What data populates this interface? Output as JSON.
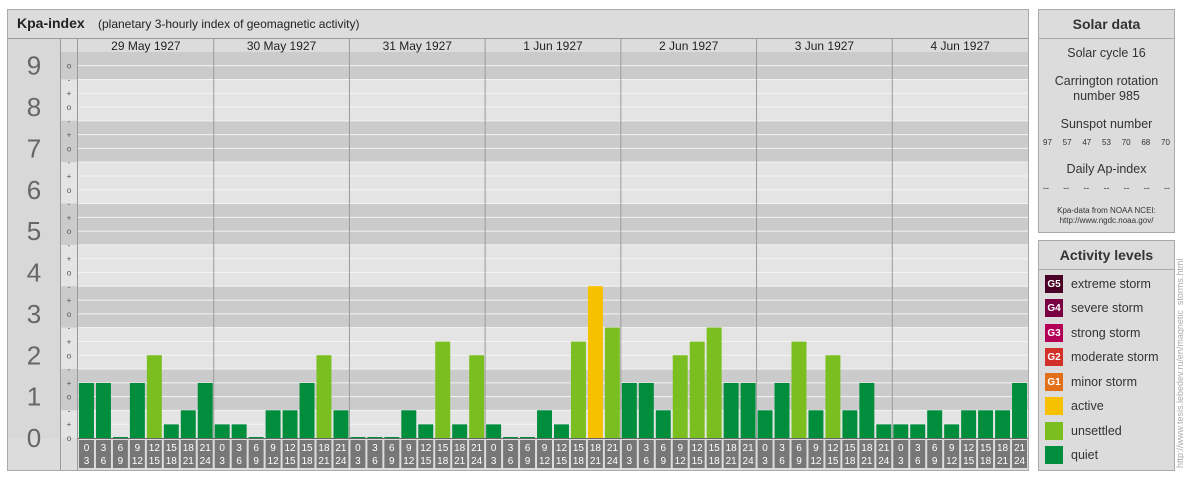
{
  "chart_data": {
    "type": "bar",
    "title": "Kpa-index",
    "subtitle": "(planetary 3-hourly index of geomagnetic activity)",
    "days": [
      "29 May 1927",
      "30 May 1927",
      "31 May 1927",
      "1 Jun 1927",
      "2 Jun 1927",
      "3 Jun 1927",
      "4 Jun 1927"
    ],
    "interval_labels": [
      [
        "0",
        "3"
      ],
      [
        "3",
        "6"
      ],
      [
        "6",
        "9"
      ],
      [
        "9",
        "12"
      ],
      [
        "12",
        "15"
      ],
      [
        "15",
        "18"
      ],
      [
        "18",
        "21"
      ],
      [
        "21",
        "24"
      ]
    ],
    "y_tick_labels": [
      "0",
      "1",
      "2",
      "3",
      "4",
      "5",
      "6",
      "7",
      "8",
      "9"
    ],
    "y_minor_labels": [
      "o",
      "+",
      "-",
      "o"
    ],
    "ylim": [
      0,
      9.33
    ],
    "values": [
      1.33,
      1.33,
      0,
      1.33,
      2,
      0.33,
      0.67,
      1.33,
      0.33,
      0.33,
      0,
      0.67,
      0.67,
      1.33,
      2,
      0.67,
      0,
      0,
      0,
      0.67,
      0.33,
      2.33,
      0.33,
      2,
      0.33,
      0,
      0,
      0.67,
      0.33,
      2.33,
      3.67,
      2.67,
      1.33,
      1.33,
      0.67,
      2,
      2.33,
      2.67,
      1.33,
      1.33,
      0.67,
      1.33,
      2.33,
      0.67,
      2,
      0.67,
      1.33,
      0.33,
      0.33,
      0.33,
      0.67,
      0.33,
      0.67,
      0.67,
      0.67,
      1.33
    ],
    "colors": {
      "quiet": "#008d3c",
      "unsettled": "#7abf1f",
      "active": "#f8c100",
      "band_dark": "#cbcbcb",
      "band_light": "#e4e4e4",
      "line": "#9a9a9a",
      "box": "#777777"
    }
  },
  "solar": {
    "title": "Solar data",
    "cycle": "Solar cycle 16",
    "carrington_line1": "Carrington rotation",
    "carrington_line2": "number 985",
    "sunspot_title": "Sunspot number",
    "sunspots": [
      "97",
      "57",
      "47",
      "53",
      "70",
      "68",
      "70"
    ],
    "ap_title": "Daily Ap-index",
    "ap_values": [
      "--",
      "--",
      "--",
      "--",
      "--",
      "--",
      "--"
    ],
    "source_line1": "Kpa-data from NOAA NCEI:",
    "source_line2": "http://www.ngdc.noaa.gov/"
  },
  "activity": {
    "title": "Activity levels",
    "levels": [
      {
        "code": "G5",
        "label": "extreme storm",
        "color": "#4a0026"
      },
      {
        "code": "G4",
        "label": "severe storm",
        "color": "#7a0044"
      },
      {
        "code": "G3",
        "label": "strong storm",
        "color": "#b30056"
      },
      {
        "code": "G2",
        "label": "moderate storm",
        "color": "#d12f27"
      },
      {
        "code": "G1",
        "label": "minor storm",
        "color": "#e2701b"
      },
      {
        "code": "",
        "label": "active",
        "color": "#f8c100"
      },
      {
        "code": "",
        "label": "unsettled",
        "color": "#7abf1f"
      },
      {
        "code": "",
        "label": "quiet",
        "color": "#008d3c"
      }
    ]
  },
  "credit": "http://www.tesis.lebedev.ru/en/magnetic_storms.html"
}
